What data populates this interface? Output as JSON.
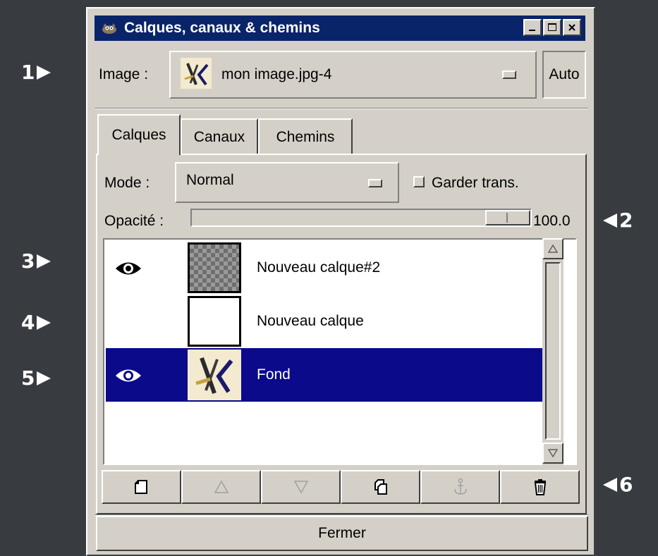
{
  "annotations": [
    "1",
    "2",
    "3",
    "4",
    "5",
    "6"
  ],
  "window": {
    "title": "Calques, canaux & chemins",
    "icon": "gimp-wilber-icon",
    "controls": [
      "minimize-icon",
      "maximize-icon",
      "close-icon"
    ]
  },
  "image_selector": {
    "label": "Image :",
    "value": "mon image.jpg-4",
    "auto_label": "Auto"
  },
  "tabs": [
    {
      "label": "Calques",
      "active": true
    },
    {
      "label": "Canaux",
      "active": false
    },
    {
      "label": "Chemins",
      "active": false
    }
  ],
  "mode": {
    "label": "Mode :",
    "value": "Normal",
    "keep_trans_label": "Garder trans.",
    "keep_trans_checked": false
  },
  "opacity": {
    "label": "Opacité :",
    "value": "100.0"
  },
  "layers": [
    {
      "name": "Nouveau calque#2",
      "visible": true,
      "selected": false,
      "thumb": "transparent-checker"
    },
    {
      "name": "Nouveau calque",
      "visible": false,
      "selected": false,
      "thumb": "white"
    },
    {
      "name": "Fond",
      "visible": true,
      "selected": true,
      "thumb": "image"
    }
  ],
  "toolbar_icons": [
    "new-layer-icon",
    "raise-layer-icon",
    "lower-layer-icon",
    "duplicate-layer-icon",
    "anchor-layer-icon",
    "delete-layer-icon"
  ],
  "close_button": "Fermer",
  "colors": {
    "background": "#383c41",
    "face": "#d4d0c8",
    "titlebar": "#0a246a",
    "selection": "#0a0a8a"
  }
}
